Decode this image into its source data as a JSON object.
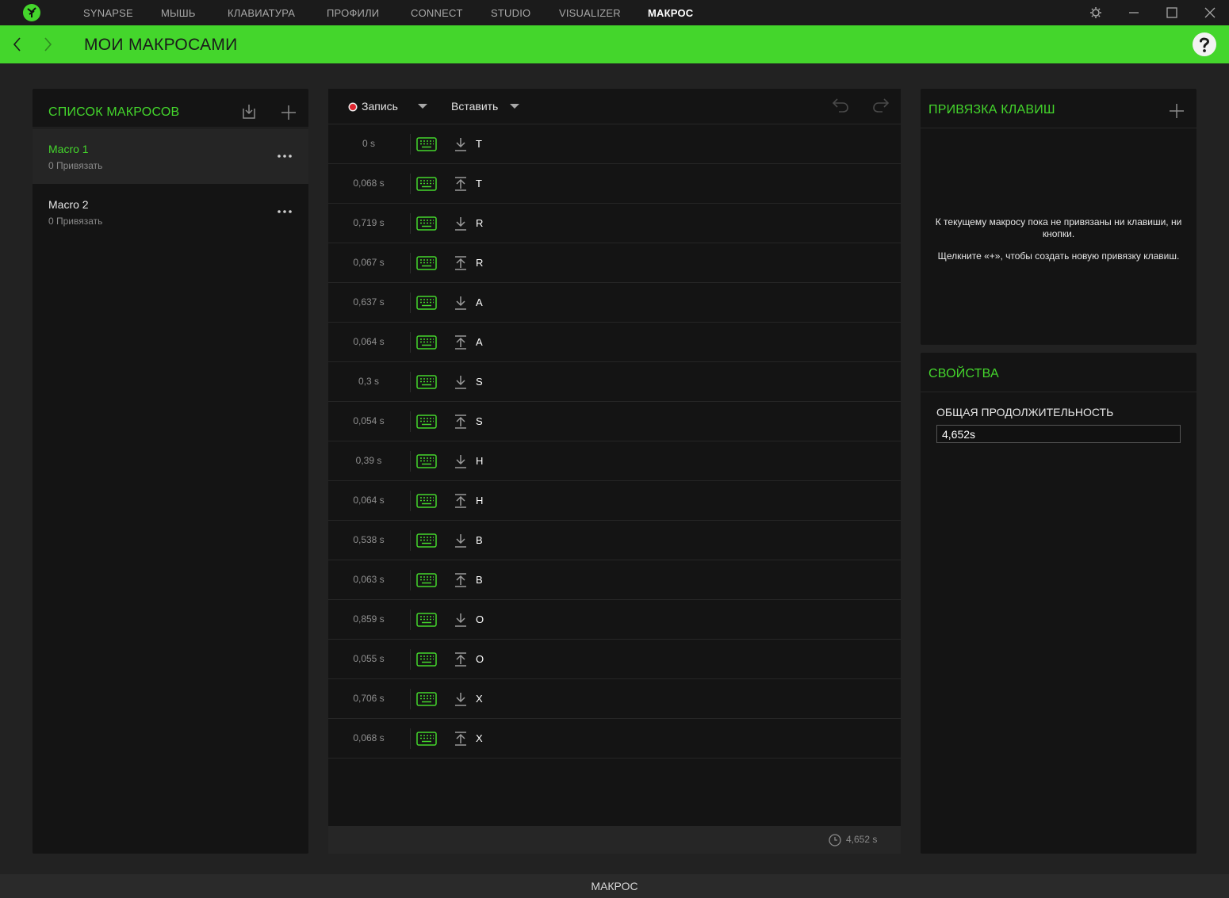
{
  "topnav": {
    "items": [
      "SYNAPSE",
      "МЫШЬ",
      "КЛАВИАТУРА",
      "ПРОФИЛИ",
      "CONNECT",
      "STUDIO",
      "VISUALIZER",
      "МАКРОС"
    ],
    "active": "МАКРОС"
  },
  "header": {
    "title": "МОИ МАКРОСАМИ"
  },
  "colors": {
    "accent": "#44d62c",
    "background": "#222222",
    "panel": "#141414",
    "record_dot": "#e0252f"
  },
  "macro_list": {
    "title": "СПИСОК МАКРОСОВ",
    "items": [
      {
        "name": "Macro 1",
        "sub": "0 Привязать",
        "selected": true
      },
      {
        "name": "Macro 2",
        "sub": "0 Привязать",
        "selected": false
      }
    ]
  },
  "editor": {
    "record_label": "Запись",
    "insert_label": "Вставить",
    "events": [
      {
        "time": "0 s",
        "dir": "down",
        "key": "T"
      },
      {
        "time": "0,068 s",
        "dir": "up",
        "key": "T"
      },
      {
        "time": "0,719 s",
        "dir": "down",
        "key": "R"
      },
      {
        "time": "0,067 s",
        "dir": "up",
        "key": "R"
      },
      {
        "time": "0,637 s",
        "dir": "down",
        "key": "A"
      },
      {
        "time": "0,064 s",
        "dir": "up",
        "key": "A"
      },
      {
        "time": "0,3 s",
        "dir": "down",
        "key": "S"
      },
      {
        "time": "0,054 s",
        "dir": "up",
        "key": "S"
      },
      {
        "time": "0,39 s",
        "dir": "down",
        "key": "H"
      },
      {
        "time": "0,064 s",
        "dir": "up",
        "key": "H"
      },
      {
        "time": "0,538 s",
        "dir": "down",
        "key": "B"
      },
      {
        "time": "0,063 s",
        "dir": "up",
        "key": "B"
      },
      {
        "time": "0,859 s",
        "dir": "down",
        "key": "O"
      },
      {
        "time": "0,055 s",
        "dir": "up",
        "key": "O"
      },
      {
        "time": "0,706 s",
        "dir": "down",
        "key": "X"
      },
      {
        "time": "0,068 s",
        "dir": "up",
        "key": "X"
      }
    ],
    "total": "4,652 s"
  },
  "keybind": {
    "title": "ПРИВЯЗКА КЛАВИШ",
    "empty_line1": "К текущему макросу пока не привязаны ни клавиши, ни кнопки.",
    "empty_line2": "Щелкните «+», чтобы создать новую привязку клавиш."
  },
  "properties": {
    "title": "СВОЙСТВА",
    "duration_label": "ОБЩАЯ ПРОДОЛЖИТЕЛЬНОСТЬ",
    "duration_value": "4,652s"
  },
  "footer": {
    "label": "МАКРОС"
  }
}
